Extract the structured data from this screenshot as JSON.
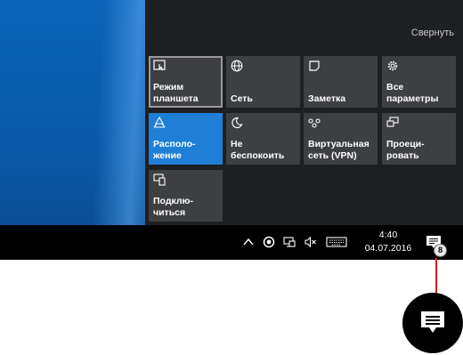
{
  "action_center": {
    "collapse_label": "Свернуть",
    "tiles": [
      {
        "label": "Режим\nпланшета",
        "icon": "tablet-mode-icon"
      },
      {
        "label": "Сеть",
        "icon": "globe-network-icon"
      },
      {
        "label": "Заметка",
        "icon": "note-icon"
      },
      {
        "label": "Все\nпараметры",
        "icon": "gear-icon"
      },
      {
        "label": "Располо-\nжение",
        "icon": "location-icon"
      },
      {
        "label": "Не\nбеспокоить",
        "icon": "moon-icon"
      },
      {
        "label": "Виртуальная\nсеть (VPN)",
        "icon": "vpn-icon"
      },
      {
        "label": "Проеци-\nровать",
        "icon": "project-icon"
      },
      {
        "label": "Подклю-\nчиться",
        "icon": "connect-icon"
      }
    ],
    "selected_tile": "Режим планшета",
    "active_tile": "Расположение",
    "colors": {
      "tile_bg": "#3d3f43",
      "active_bg": "#1f7fd6",
      "panel_bg": "#1e1f22"
    }
  },
  "taskbar": {
    "time": "4:40",
    "date": "04.07.2016",
    "notification_count": "8",
    "tray_icons": [
      "chevron-up-icon",
      "record-icon",
      "network-icon",
      "volume-mute-icon",
      "keyboard-icon"
    ]
  },
  "callout": {
    "icon": "action-center-icon",
    "line_color": "#e21b1b"
  }
}
